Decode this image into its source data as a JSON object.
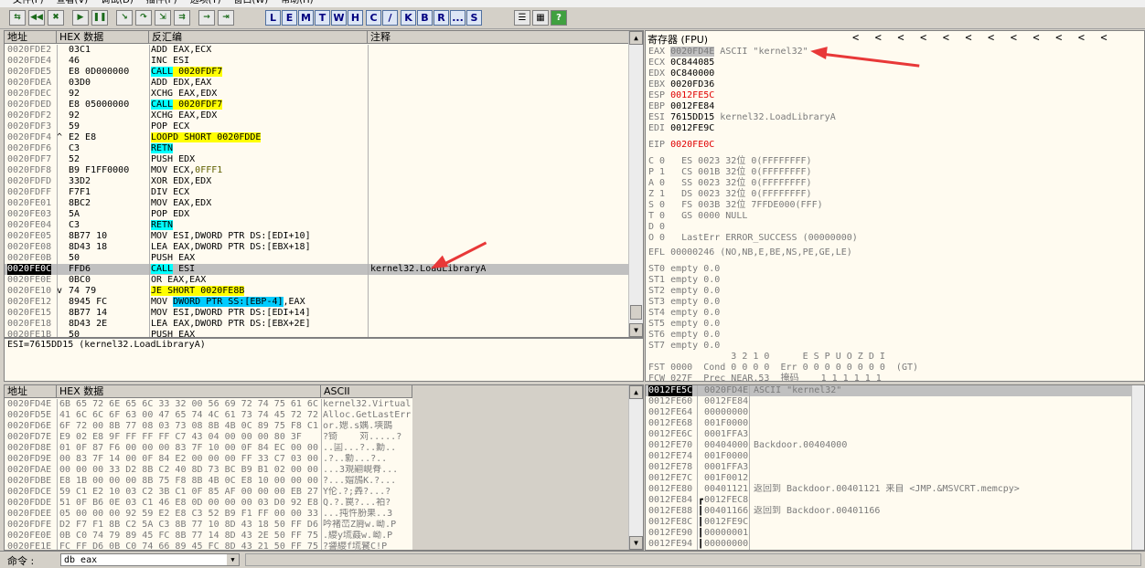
{
  "menubar": {
    "items": [
      "文件(F)",
      "查看(V)",
      "调试(D)",
      "插件(P)",
      "选项(T)",
      "窗口(W)",
      "帮助(H)"
    ]
  },
  "toolbar": {
    "icons": [
      "open-icon",
      "rewind-icon",
      "close-icon",
      "run-icon",
      "pause-icon",
      "step-into-icon",
      "step-over-icon",
      "trace-into-icon",
      "trace-over-icon",
      "execute-till-return-icon",
      "goto-icon"
    ],
    "letters": [
      "L",
      "E",
      "M",
      "T",
      "W",
      "H",
      "C",
      "/",
      "K",
      "B",
      "R",
      "...",
      "S"
    ],
    "right_icons": [
      "list-icon",
      "grid-icon",
      "help-icon"
    ]
  },
  "disasm": {
    "headers": {
      "address": "地址",
      "hex": "HEX 数据",
      "disasm": "反汇编",
      "comment": "注释"
    },
    "rows": [
      {
        "addr": "0020FDE2",
        "mark": "",
        "hex": "03C1",
        "asm": "ADD EAX,ECX",
        "hl": "",
        "comment": ""
      },
      {
        "addr": "0020FDE4",
        "mark": "",
        "hex": "46",
        "asm": "INC ESI",
        "hl": "",
        "comment": ""
      },
      {
        "addr": "0020FDE5",
        "mark": "",
        "hex": "E8 0D000000",
        "asm": "CALL 0020FDF7",
        "hl": "call",
        "comment": ""
      },
      {
        "addr": "0020FDEA",
        "mark": "",
        "hex": "03D0",
        "asm": "ADD EDX,EAX",
        "hl": "",
        "comment": ""
      },
      {
        "addr": "0020FDEC",
        "mark": "",
        "hex": "92",
        "asm": "XCHG EAX,EDX",
        "hl": "",
        "comment": ""
      },
      {
        "addr": "0020FDED",
        "mark": "",
        "hex": "E8 05000000",
        "asm": "CALL 0020FDF7",
        "hl": "call",
        "comment": ""
      },
      {
        "addr": "0020FDF2",
        "mark": "",
        "hex": "92",
        "asm": "XCHG EAX,EDX",
        "hl": "",
        "comment": ""
      },
      {
        "addr": "0020FDF3",
        "mark": "",
        "hex": "59",
        "asm": "POP ECX",
        "hl": "",
        "comment": ""
      },
      {
        "addr": "0020FDF4",
        "mark": "^",
        "hex": "E2 E8",
        "asm": "LOOPD SHORT 0020FDDE",
        "hl": "jmp",
        "comment": ""
      },
      {
        "addr": "0020FDF6",
        "mark": "",
        "hex": "C3",
        "asm": "RETN",
        "hl": "ret",
        "comment": ""
      },
      {
        "addr": "0020FDF7",
        "mark": "",
        "hex": "52",
        "asm": "PUSH EDX",
        "hl": "",
        "comment": ""
      },
      {
        "addr": "0020FDF8",
        "mark": "",
        "hex": "B9 F1FF0000",
        "asm": "MOV ECX,0FFF1",
        "hl": "",
        "comment": ""
      },
      {
        "addr": "0020FDFD",
        "mark": "",
        "hex": "33D2",
        "asm": "XOR EDX,EDX",
        "hl": "",
        "comment": ""
      },
      {
        "addr": "0020FDFF",
        "mark": "",
        "hex": "F7F1",
        "asm": "DIV ECX",
        "hl": "",
        "comment": ""
      },
      {
        "addr": "0020FE01",
        "mark": "",
        "hex": "8BC2",
        "asm": "MOV EAX,EDX",
        "hl": "",
        "comment": ""
      },
      {
        "addr": "0020FE03",
        "mark": "",
        "hex": "5A",
        "asm": "POP EDX",
        "hl": "",
        "comment": ""
      },
      {
        "addr": "0020FE04",
        "mark": "",
        "hex": "C3",
        "asm": "RETN",
        "hl": "ret",
        "comment": ""
      },
      {
        "addr": "0020FE05",
        "mark": "",
        "hex": "8B77 10",
        "asm": "MOV ESI,DWORD PTR DS:[EDI+10]",
        "hl": "",
        "comment": ""
      },
      {
        "addr": "0020FE08",
        "mark": "",
        "hex": "8D43 18",
        "asm": "LEA EAX,DWORD PTR DS:[EBX+18]",
        "hl": "",
        "comment": ""
      },
      {
        "addr": "0020FE0B",
        "mark": "",
        "hex": "50",
        "asm": "PUSH EAX",
        "hl": "",
        "comment": ""
      },
      {
        "addr": "0020FE0C",
        "mark": "",
        "hex": "FFD6",
        "asm": "CALL ESI",
        "hl": "call",
        "comment": "kernel32.LoadLibraryA",
        "selected": true
      },
      {
        "addr": "0020FE0E",
        "mark": "",
        "hex": "0BC0",
        "asm": "OR EAX,EAX",
        "hl": "",
        "comment": ""
      },
      {
        "addr": "0020FE10",
        "mark": "v",
        "hex": "74 79",
        "asm": "JE SHORT 0020FE8B",
        "hl": "jmp",
        "comment": ""
      },
      {
        "addr": "0020FE12",
        "mark": "",
        "hex": "8945 FC",
        "asm": "MOV DWORD PTR SS:[EBP-4],EAX",
        "hl": "mem",
        "comment": ""
      },
      {
        "addr": "0020FE15",
        "mark": "",
        "hex": "8B77 14",
        "asm": "MOV ESI,DWORD PTR DS:[EDI+14]",
        "hl": "",
        "comment": ""
      },
      {
        "addr": "0020FE18",
        "mark": "",
        "hex": "8D43 2E",
        "asm": "LEA EAX,DWORD PTR DS:[EBX+2E]",
        "hl": "",
        "comment": ""
      },
      {
        "addr": "0020FE1B",
        "mark": "",
        "hex": "50",
        "asm": "PUSH EAX",
        "hl": "",
        "comment": ""
      }
    ]
  },
  "info": {
    "text": "ESI=7615DD15 (kernel32.LoadLibraryA)"
  },
  "registers": {
    "title": "寄存器 (FPU)",
    "nav": "<  <  <  <  <  <  <  <  <  <  <  <",
    "gpr": [
      {
        "name": "EAX",
        "value": "0020FD4E",
        "note": "ASCII \"kernel32\"",
        "style": "grey"
      },
      {
        "name": "ECX",
        "value": "0C844085",
        "note": "",
        "style": ""
      },
      {
        "name": "EDX",
        "value": "0C840000",
        "note": "",
        "style": ""
      },
      {
        "name": "EBX",
        "value": "0020FD36",
        "note": "",
        "style": ""
      },
      {
        "name": "ESP",
        "value": "0012FE5C",
        "note": "",
        "style": "red"
      },
      {
        "name": "EBP",
        "value": "0012FE84",
        "note": "",
        "style": ""
      },
      {
        "name": "ESI",
        "value": "7615DD15",
        "note": "kernel32.LoadLibraryA",
        "style": ""
      },
      {
        "name": "EDI",
        "value": "0012FE9C",
        "note": "",
        "style": ""
      }
    ],
    "eip": {
      "name": "EIP",
      "value": "0020FE0C"
    },
    "flags": [
      "C 0   ES 0023 32位 0(FFFFFFFF)",
      "P 1   CS 001B 32位 0(FFFFFFFF)",
      "A 0   SS 0023 32位 0(FFFFFFFF)",
      "Z 1   DS 0023 32位 0(FFFFFFFF)",
      "S 0   FS 003B 32位 7FFDE000(FFF)",
      "T 0   GS 0000 NULL",
      "D 0",
      "O 0   LastErr ERROR_SUCCESS (00000000)"
    ],
    "efl": "EFL 00000246 (NO,NB,E,BE,NS,PE,GE,LE)",
    "fpu": [
      "ST0 empty 0.0",
      "ST1 empty 0.0",
      "ST2 empty 0.0",
      "ST3 empty 0.0",
      "ST4 empty 0.0",
      "ST5 empty 0.0",
      "ST6 empty 0.0",
      "ST7 empty 0.0"
    ],
    "fpu_hdr": "               3 2 1 0      E S P U O Z D I",
    "fst": "FST 0000  Cond 0 0 0 0  Err 0 0 0 0 0 0 0 0  (GT)",
    "fcw": "FCW 027F  Prec NEAR,53  掩码    1 1 1 1 1 1"
  },
  "dump": {
    "headers": {
      "address": "地址",
      "hex": "HEX 数据",
      "ascii": "ASCII"
    },
    "rows": [
      {
        "addr": "0020FD4E",
        "hex": "6B 65 72 6E 65 6C 33 32 00 56 69 72 74 75 61 6C",
        "ascii": "kernel32.Virtual"
      },
      {
        "addr": "0020FD5E",
        "hex": "41 6C 6C 6F 63 00 47 65 74 4C 61 73 74 45 72 72",
        "ascii": "Alloc.GetLastErr"
      },
      {
        "addr": "0020FD6E",
        "hex": "6F 72 00 8B 77 08 03 73 08 8B 4B 0C 89 75 F8 C1",
        "ascii": "or.媤.s媀.塽鵲"
      },
      {
        "addr": "0020FD7E",
        "hex": "E9 02 E8 9F FF FF FF C7 43 04 00 00 00 80 3F",
        "ascii": "?锜    苅.....?"
      },
      {
        "addr": "0020FD8E",
        "hex": "01 0F 87 F6 00 00 00 83 7F 10 00 0F 84 EC 00 00",
        "ascii": "..囸...?..勳.."
      },
      {
        "addr": "0020FD9E",
        "hex": "00 83 7F 14 00 0F 84 E2 00 00 00 FF 33 C7 03 00",
        "ascii": ".?..勨...?.."
      },
      {
        "addr": "0020FDAE",
        "hex": "00 00 00 33 D2 8B C2 40 8D 73 BC B9 B1 02 00 00",
        "ascii": "...3覌翤峴脊..."
      },
      {
        "addr": "0020FDBE",
        "hex": "E8 1B 00 00 00 8B 75 F8 8B 4B 0C E8 10 00 00 00",
        "ascii": "?...媢鴋K.?..."
      },
      {
        "addr": "0020FDCE",
        "hex": "59 C1 E2 10 03 C2 3B C1 0F 85 AF 00 00 00 EB 27",
        "ascii": "Y伦.?;羴?...?"
      },
      {
        "addr": "0020FDDE",
        "hex": "51 0F B6 0E 03 C1 46 E8 0D 00 00 00 03 D0 92 E8",
        "ascii": "Q.?.罠?...袙?"
      },
      {
        "addr": "0020FDEE",
        "hex": "05 00 00 00 92 59 E2 E8 C3 52 B9 F1 FF 00 00 33",
        "ascii": "...扽忤肦果..3"
      },
      {
        "addr": "0020FDFE",
        "hex": "D2 F7 F1 8B C2 5A C3 8B 77 10 8D 43 18 50 FF D6",
        "ascii": "吟褚峦Z脣w.岰.P"
      },
      {
        "addr": "0020FE0E",
        "hex": "0B C0 74 79 89 45 FC 8B 77 14 8D 43 2E 50 FF 75",
        "ascii": ".纓y塃鼖w.岰.P"
      },
      {
        "addr": "0020FE1E",
        "hex": "FC FF D6 0B C0 74 66 89 45 FC 8D 43 21 50 FF 75",
        "ascii": "?謽纓f塃鼚C!P"
      }
    ]
  },
  "stack": {
    "rows": [
      {
        "addr": "0012FE5C",
        "value": "0020FD4E",
        "note": "ASCII \"kernel32\"",
        "selected": true,
        "bracket": ""
      },
      {
        "addr": "0012FE60",
        "value": "0012FE84",
        "note": "",
        "bracket": ""
      },
      {
        "addr": "0012FE64",
        "value": "00000000",
        "note": "",
        "bracket": ""
      },
      {
        "addr": "0012FE68",
        "value": "001F0000",
        "note": "",
        "bracket": ""
      },
      {
        "addr": "0012FE6C",
        "value": "0001FFA3",
        "note": "",
        "bracket": ""
      },
      {
        "addr": "0012FE70",
        "value": "00404000",
        "note": "Backdoor.00404000",
        "bracket": ""
      },
      {
        "addr": "0012FE74",
        "value": "001F0000",
        "note": "",
        "bracket": ""
      },
      {
        "addr": "0012FE78",
        "value": "0001FFA3",
        "note": "",
        "bracket": ""
      },
      {
        "addr": "0012FE7C",
        "value": "001F0012",
        "note": "",
        "bracket": ""
      },
      {
        "addr": "0012FE80",
        "value": "00401121",
        "note": "返回到 Backdoor.00401121 来自 <JMP.&MSVCRT.memcpy>",
        "bracket": ""
      },
      {
        "addr": "0012FE84",
        "value": "0012FEC8",
        "note": "",
        "bracket": "start"
      },
      {
        "addr": "0012FE88",
        "value": "00401166",
        "note": "返回到 Backdoor.00401166",
        "bracket": "mid"
      },
      {
        "addr": "0012FE8C",
        "value": "0012FE9C",
        "note": "",
        "bracket": "mid"
      },
      {
        "addr": "0012FE90",
        "value": "00000001",
        "note": "",
        "bracket": "mid"
      },
      {
        "addr": "0012FE94",
        "value": "00000000",
        "note": "",
        "bracket": "mid"
      }
    ]
  },
  "command": {
    "label": "命令 :",
    "value": "db eax"
  },
  "colors": {
    "arrow": "#e83838",
    "call": "#00ffff",
    "jump": "#ffff00",
    "selected": "#c0c0c0",
    "esp": "#e00000"
  }
}
